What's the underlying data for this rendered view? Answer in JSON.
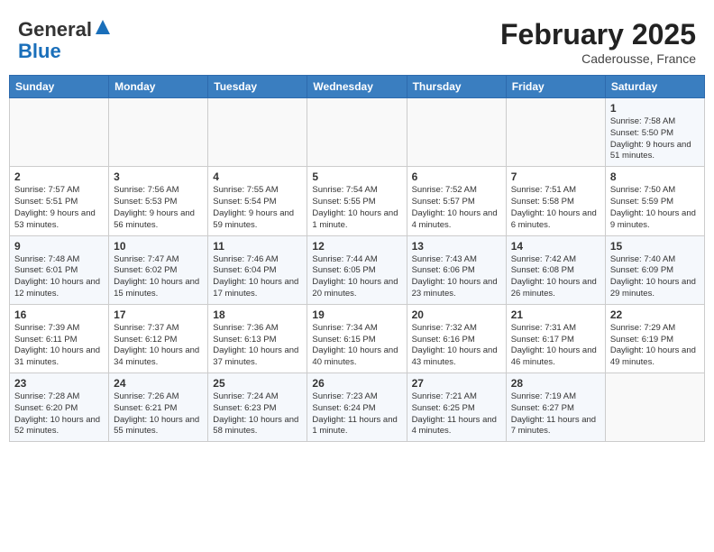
{
  "header": {
    "logo_general": "General",
    "logo_blue": "Blue",
    "month_year": "February 2025",
    "location": "Caderousse, France"
  },
  "days_of_week": [
    "Sunday",
    "Monday",
    "Tuesday",
    "Wednesday",
    "Thursday",
    "Friday",
    "Saturday"
  ],
  "weeks": [
    [
      {
        "day": "",
        "content": ""
      },
      {
        "day": "",
        "content": ""
      },
      {
        "day": "",
        "content": ""
      },
      {
        "day": "",
        "content": ""
      },
      {
        "day": "",
        "content": ""
      },
      {
        "day": "",
        "content": ""
      },
      {
        "day": "1",
        "content": "Sunrise: 7:58 AM\nSunset: 5:50 PM\nDaylight: 9 hours and 51 minutes."
      }
    ],
    [
      {
        "day": "2",
        "content": "Sunrise: 7:57 AM\nSunset: 5:51 PM\nDaylight: 9 hours and 53 minutes."
      },
      {
        "day": "3",
        "content": "Sunrise: 7:56 AM\nSunset: 5:53 PM\nDaylight: 9 hours and 56 minutes."
      },
      {
        "day": "4",
        "content": "Sunrise: 7:55 AM\nSunset: 5:54 PM\nDaylight: 9 hours and 59 minutes."
      },
      {
        "day": "5",
        "content": "Sunrise: 7:54 AM\nSunset: 5:55 PM\nDaylight: 10 hours and 1 minute."
      },
      {
        "day": "6",
        "content": "Sunrise: 7:52 AM\nSunset: 5:57 PM\nDaylight: 10 hours and 4 minutes."
      },
      {
        "day": "7",
        "content": "Sunrise: 7:51 AM\nSunset: 5:58 PM\nDaylight: 10 hours and 6 minutes."
      },
      {
        "day": "8",
        "content": "Sunrise: 7:50 AM\nSunset: 5:59 PM\nDaylight: 10 hours and 9 minutes."
      }
    ],
    [
      {
        "day": "9",
        "content": "Sunrise: 7:48 AM\nSunset: 6:01 PM\nDaylight: 10 hours and 12 minutes."
      },
      {
        "day": "10",
        "content": "Sunrise: 7:47 AM\nSunset: 6:02 PM\nDaylight: 10 hours and 15 minutes."
      },
      {
        "day": "11",
        "content": "Sunrise: 7:46 AM\nSunset: 6:04 PM\nDaylight: 10 hours and 17 minutes."
      },
      {
        "day": "12",
        "content": "Sunrise: 7:44 AM\nSunset: 6:05 PM\nDaylight: 10 hours and 20 minutes."
      },
      {
        "day": "13",
        "content": "Sunrise: 7:43 AM\nSunset: 6:06 PM\nDaylight: 10 hours and 23 minutes."
      },
      {
        "day": "14",
        "content": "Sunrise: 7:42 AM\nSunset: 6:08 PM\nDaylight: 10 hours and 26 minutes."
      },
      {
        "day": "15",
        "content": "Sunrise: 7:40 AM\nSunset: 6:09 PM\nDaylight: 10 hours and 29 minutes."
      }
    ],
    [
      {
        "day": "16",
        "content": "Sunrise: 7:39 AM\nSunset: 6:11 PM\nDaylight: 10 hours and 31 minutes."
      },
      {
        "day": "17",
        "content": "Sunrise: 7:37 AM\nSunset: 6:12 PM\nDaylight: 10 hours and 34 minutes."
      },
      {
        "day": "18",
        "content": "Sunrise: 7:36 AM\nSunset: 6:13 PM\nDaylight: 10 hours and 37 minutes."
      },
      {
        "day": "19",
        "content": "Sunrise: 7:34 AM\nSunset: 6:15 PM\nDaylight: 10 hours and 40 minutes."
      },
      {
        "day": "20",
        "content": "Sunrise: 7:32 AM\nSunset: 6:16 PM\nDaylight: 10 hours and 43 minutes."
      },
      {
        "day": "21",
        "content": "Sunrise: 7:31 AM\nSunset: 6:17 PM\nDaylight: 10 hours and 46 minutes."
      },
      {
        "day": "22",
        "content": "Sunrise: 7:29 AM\nSunset: 6:19 PM\nDaylight: 10 hours and 49 minutes."
      }
    ],
    [
      {
        "day": "23",
        "content": "Sunrise: 7:28 AM\nSunset: 6:20 PM\nDaylight: 10 hours and 52 minutes."
      },
      {
        "day": "24",
        "content": "Sunrise: 7:26 AM\nSunset: 6:21 PM\nDaylight: 10 hours and 55 minutes."
      },
      {
        "day": "25",
        "content": "Sunrise: 7:24 AM\nSunset: 6:23 PM\nDaylight: 10 hours and 58 minutes."
      },
      {
        "day": "26",
        "content": "Sunrise: 7:23 AM\nSunset: 6:24 PM\nDaylight: 11 hours and 1 minute."
      },
      {
        "day": "27",
        "content": "Sunrise: 7:21 AM\nSunset: 6:25 PM\nDaylight: 11 hours and 4 minutes."
      },
      {
        "day": "28",
        "content": "Sunrise: 7:19 AM\nSunset: 6:27 PM\nDaylight: 11 hours and 7 minutes."
      },
      {
        "day": "",
        "content": ""
      }
    ]
  ]
}
